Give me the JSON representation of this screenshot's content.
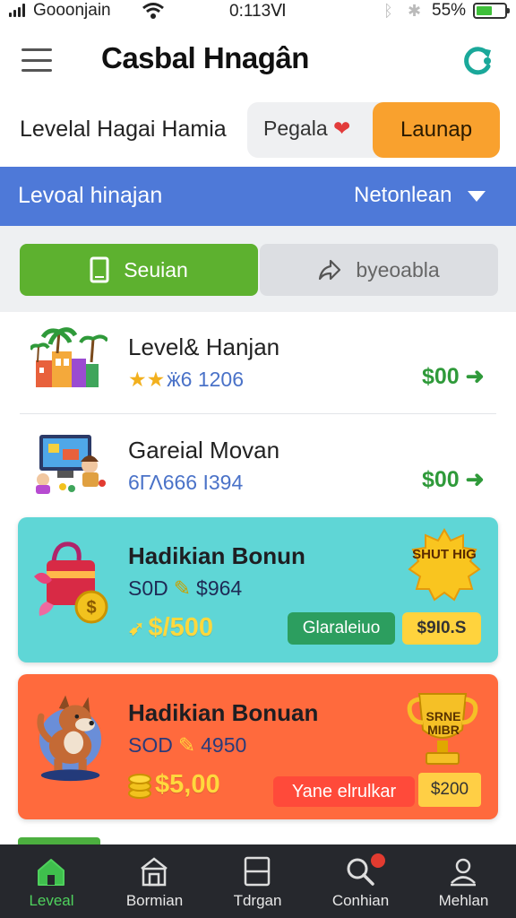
{
  "status_bar": {
    "carrier": "Gooonjain",
    "time": "0:113Ⅵ",
    "battery_percent": "55%",
    "battery_level": 0.55
  },
  "header": {
    "title": "Casbal Hnagân"
  },
  "level_row": {
    "label": "Levelal Hagai Hamia",
    "option_label": "Pegala",
    "launch_label": "Launap"
  },
  "section_bar": {
    "title": "Levoal hinajan",
    "dropdown_label": "Netonlean"
  },
  "tabs": [
    {
      "label": "Seuian",
      "icon": "phone-icon",
      "active": true
    },
    {
      "label": "byeoabla",
      "icon": "share-icon",
      "active": false
    }
  ],
  "list_items": [
    {
      "name": "Level& Hanjan",
      "sub": "ӝ6 1206",
      "price": "$00",
      "thumb": "resort-icon"
    },
    {
      "name": "Gareial Movan",
      "sub": "6ΓΛ666 I394",
      "price": "$00",
      "thumb": "arcade-icon"
    }
  ],
  "bonus_cards": [
    {
      "title": "Hadikian Bonun",
      "sub_prefix": "S0D",
      "sub_value": "$964",
      "big_value": "$/500",
      "pill_label": "Glaraleiuo",
      "pill_value": "$9I0.S",
      "badge_text": "SHUT HIG",
      "art": "gift-bag-icon",
      "color": "#5fd6d6"
    },
    {
      "title": "Hadikian Bonuan",
      "sub_prefix": "SOD",
      "sub_value": "4950",
      "big_value": "$5,00",
      "pill_label": "Yane elrulkar",
      "pill_value": "$200",
      "badge_text": "SRNE MIBR",
      "art": "dog-icon",
      "color": "#ff6a3d"
    }
  ],
  "bottom_nav": [
    {
      "label": "Leveal",
      "icon": "home-icon",
      "active": true
    },
    {
      "label": "Bormian",
      "icon": "store-icon",
      "active": false
    },
    {
      "label": "Tdrgan",
      "icon": "square-icon",
      "active": false
    },
    {
      "label": "Conhian",
      "icon": "search-icon",
      "active": false
    },
    {
      "label": "Mehlan",
      "icon": "profile-icon",
      "active": false
    }
  ]
}
